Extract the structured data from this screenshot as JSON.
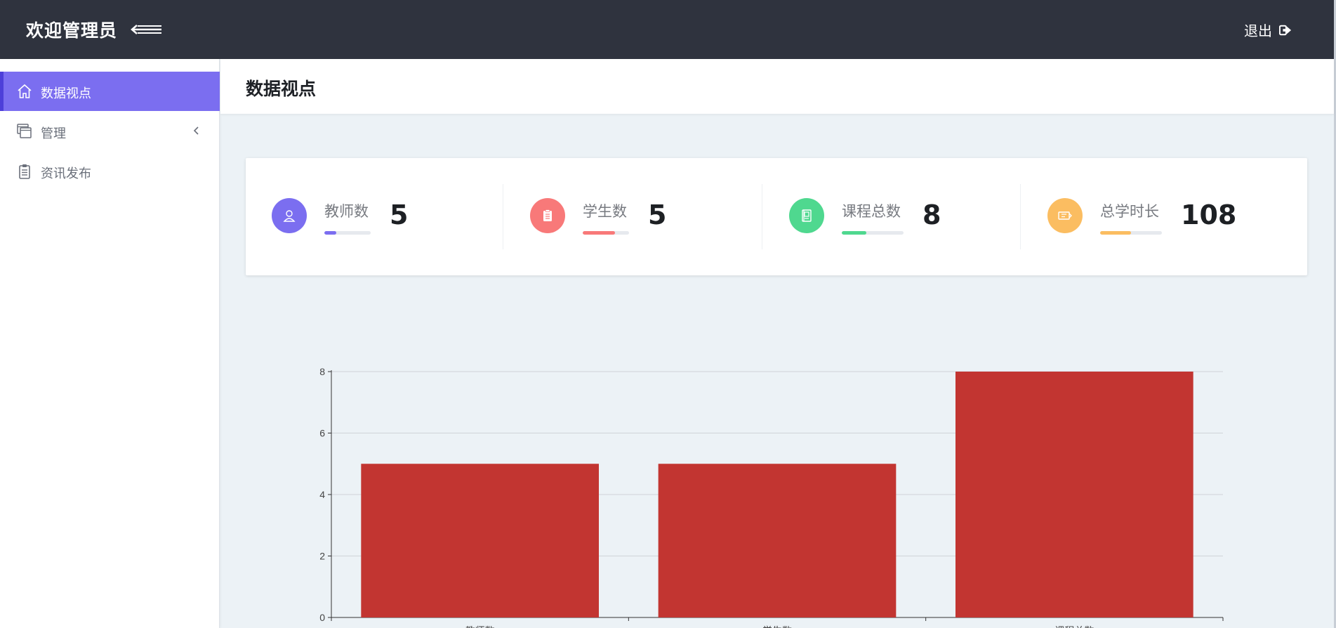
{
  "header": {
    "brand": "欢迎管理员",
    "logout_label": "退出"
  },
  "sidebar": {
    "items": [
      {
        "label": "数据视点",
        "icon": "home-icon",
        "active": true
      },
      {
        "label": "管理",
        "icon": "windows-icon",
        "active": false,
        "has_submenu": true
      },
      {
        "label": "资讯发布",
        "icon": "clipboard-icon",
        "active": false
      }
    ]
  },
  "page": {
    "title": "数据视点"
  },
  "stats": [
    {
      "label": "教师数",
      "value": "5",
      "icon": "user-icon",
      "color": "#7b6ef0",
      "progress": 0.25
    },
    {
      "label": "学生数",
      "value": "5",
      "icon": "clipboard-icon",
      "color": "#f87979",
      "progress": 0.7
    },
    {
      "label": "课程总数",
      "value": "8",
      "icon": "book-icon",
      "color": "#4fd88f",
      "progress": 0.4
    },
    {
      "label": "总学时长",
      "value": "108",
      "icon": "ticket-icon",
      "color": "#fbbd61",
      "progress": 0.5
    }
  ],
  "chart_data": {
    "type": "bar",
    "categories": [
      "教师数",
      "学生数",
      "课程总数"
    ],
    "values": [
      5,
      5,
      8
    ],
    "ylim": [
      0,
      8
    ],
    "yticks": [
      0,
      2,
      4,
      6,
      8
    ],
    "color": "#c23531",
    "grid": true
  }
}
